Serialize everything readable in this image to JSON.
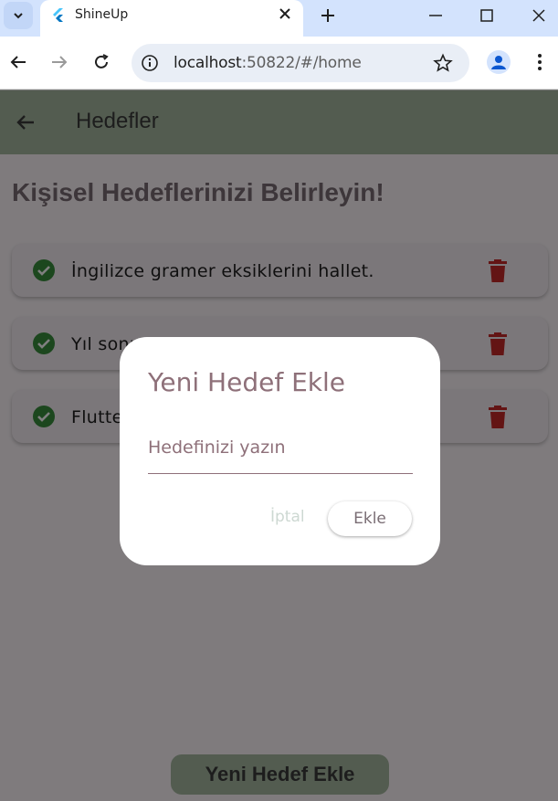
{
  "browser": {
    "tab": {
      "title": "ShineUp"
    },
    "address": {
      "host": "localhost",
      "path": ":50822/#/home"
    }
  },
  "app": {
    "appbar_title": "Hedefler",
    "heading": "Kişisel Hedeflerinizi Belirleyin!",
    "goals": [
      {
        "text": "İngilizce gramer eksiklerini hallet."
      },
      {
        "text": "Yıl sonu ... Dü..."
      },
      {
        "text": "Flutte..."
      }
    ],
    "add_button_label": "Yeni Hedef Ekle"
  },
  "dialog": {
    "title": "Yeni Hedef Ekle",
    "input_placeholder": "Hedefinizi yazın",
    "input_value": "",
    "cancel_label": "İptal",
    "add_label": "Ekle"
  },
  "colors": {
    "appbar": "#a6b8a1",
    "check_green": "#388e3c",
    "trash_red": "#c62828",
    "dialog_title": "#8e7079"
  }
}
